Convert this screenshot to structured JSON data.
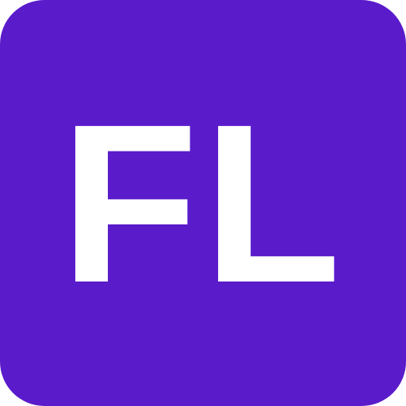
{
  "icon": {
    "monogram": "FL",
    "background_color": "#5a1bcb",
    "text_color": "#ffffff"
  }
}
